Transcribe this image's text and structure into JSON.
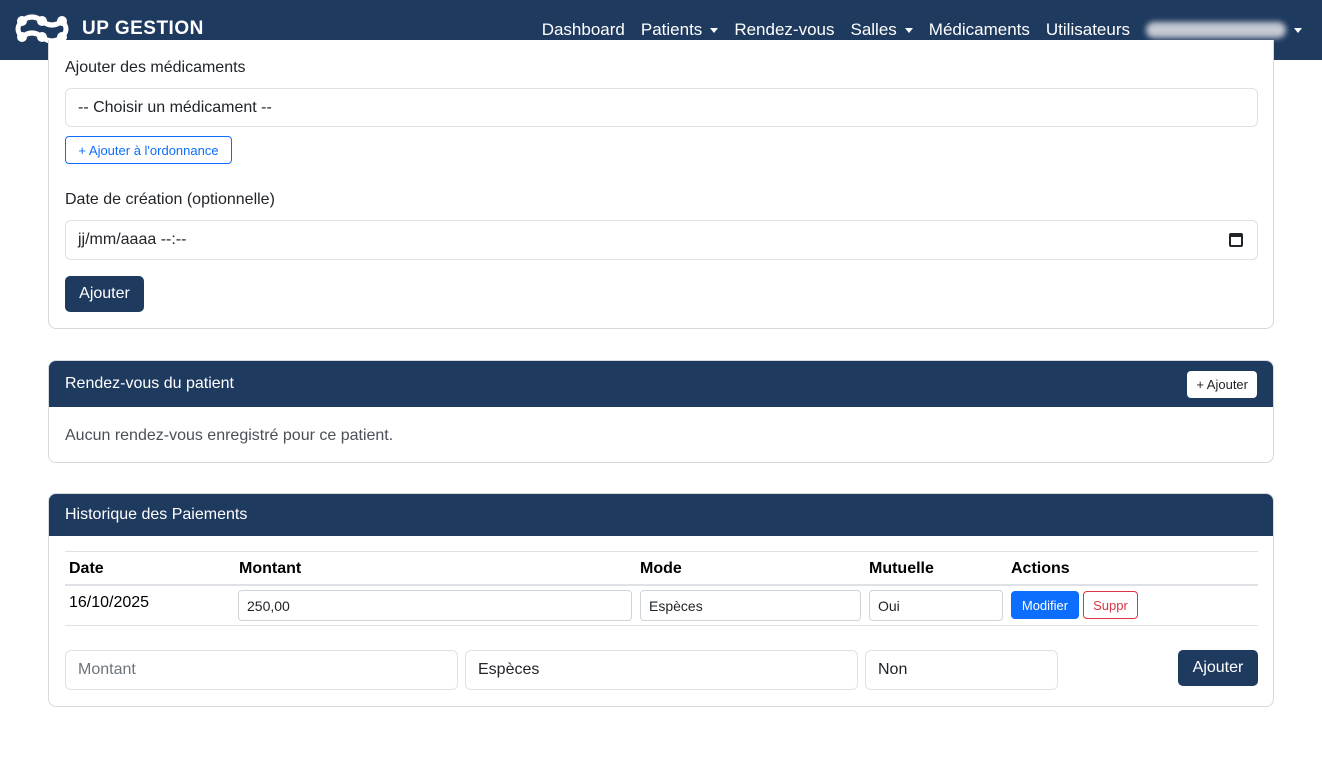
{
  "brand": {
    "name": "UP GESTION",
    "logo_icon": "molecule-logo-icon"
  },
  "nav": {
    "items": [
      {
        "label": "Dashboard",
        "dropdown": false
      },
      {
        "label": "Patients",
        "dropdown": true
      },
      {
        "label": "Rendez-vous",
        "dropdown": false
      },
      {
        "label": "Salles",
        "dropdown": true
      },
      {
        "label": "Médicaments",
        "dropdown": false
      },
      {
        "label": "Utilisateurs",
        "dropdown": false
      }
    ]
  },
  "ordonnance": {
    "medicaments_label": "Ajouter des médicaments",
    "select_value": "-- Choisir un médicament --",
    "add_button": "+ Ajouter à l'ordonnance",
    "date_label": "Date de création (optionnelle)",
    "date_placeholder": "jj/mm/aaaa --:--",
    "submit": "Ajouter"
  },
  "rendezvous": {
    "title": "Rendez-vous du patient",
    "add_button": "+ Ajouter",
    "empty": "Aucun rendez-vous enregistré pour ce patient."
  },
  "paiements": {
    "title": "Historique des Paiements",
    "columns": [
      "Date",
      "Montant",
      "Mode",
      "Mutuelle",
      "Actions"
    ],
    "rows": [
      {
        "date": "16/10/2025",
        "montant": "250,00",
        "mode": "Espèces",
        "mutuelle": "Oui",
        "edit": "Modifier",
        "delete": "Suppr"
      }
    ],
    "new": {
      "montant_placeholder": "Montant",
      "mode": "Espèces",
      "mutuelle": "Non",
      "submit": "Ajouter"
    }
  },
  "colors": {
    "primary": "#1e3a5f",
    "accent": "#0d6efd",
    "danger": "#dc3545"
  }
}
